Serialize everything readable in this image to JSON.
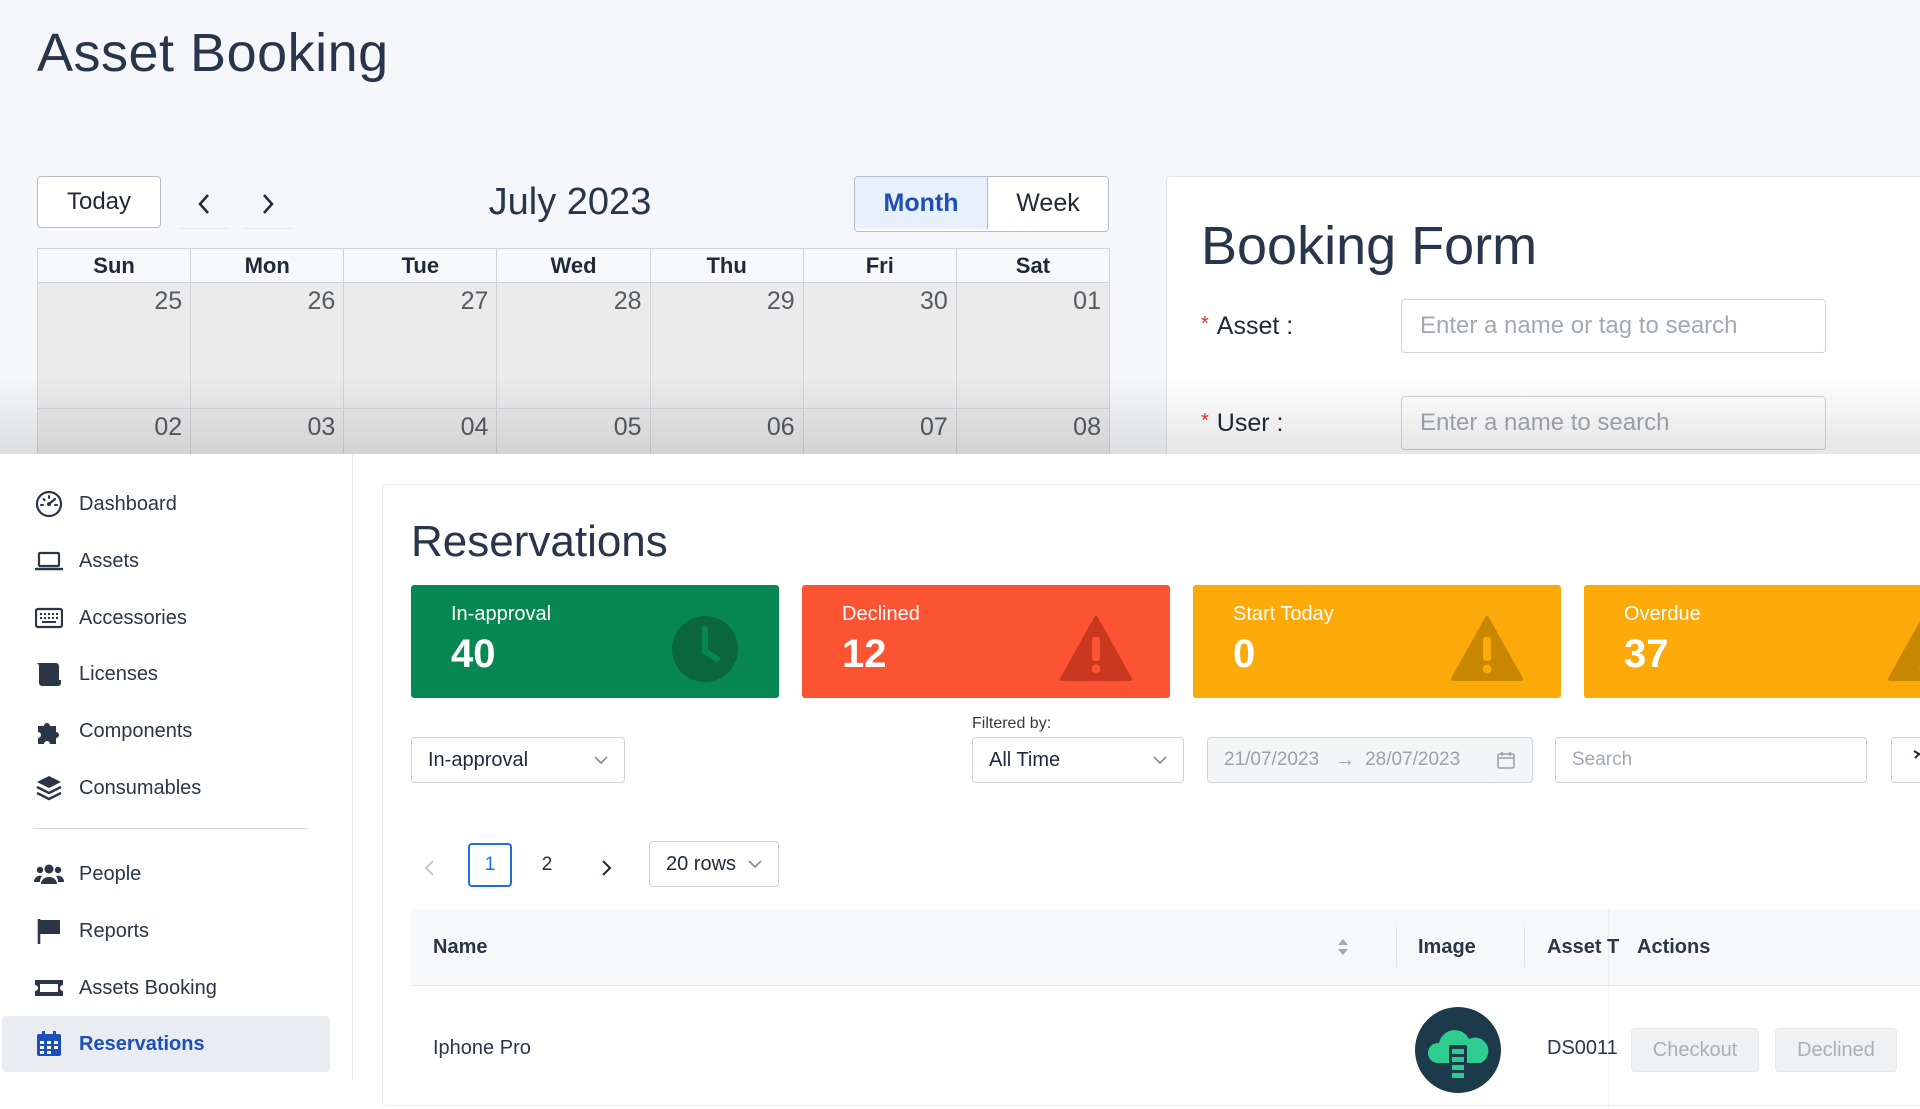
{
  "booking": {
    "title": "Asset Booking",
    "today_label": "Today",
    "month_label": "July 2023",
    "view_month": "Month",
    "view_week": "Week",
    "weekdays": [
      "Sun",
      "Mon",
      "Tue",
      "Wed",
      "Thu",
      "Fri",
      "Sat"
    ],
    "week1": [
      "25",
      "26",
      "27",
      "28",
      "29",
      "30",
      "01"
    ],
    "week2": [
      "02",
      "03",
      "04",
      "05",
      "06",
      "07",
      "08"
    ],
    "form": {
      "title": "Booking Form",
      "required_mark": "*",
      "asset_label": "Asset :",
      "asset_placeholder": "Enter a name or tag to search",
      "user_label": "User :",
      "user_placeholder": "Enter a name to search"
    }
  },
  "sidebar": {
    "items": [
      {
        "label": "Dashboard",
        "icon": "gauge-icon"
      },
      {
        "label": "Assets",
        "icon": "laptop-icon"
      },
      {
        "label": "Accessories",
        "icon": "keyboard-icon"
      },
      {
        "label": "Licenses",
        "icon": "scroll-icon"
      },
      {
        "label": "Components",
        "icon": "puzzle-icon"
      },
      {
        "label": "Consumables",
        "icon": "layers-icon"
      },
      {
        "label": "People",
        "icon": "people-icon"
      },
      {
        "label": "Reports",
        "icon": "flag-icon"
      },
      {
        "label": "Assets Booking",
        "icon": "ticket-icon"
      },
      {
        "label": "Reservations",
        "icon": "calendar-icon",
        "active": true
      }
    ]
  },
  "reservations": {
    "title": "Reservations",
    "stats": [
      {
        "label": "In-approval",
        "value": "40",
        "color": "#078852",
        "icon": "clock-icon"
      },
      {
        "label": "Declined",
        "value": "12",
        "color": "#fc5333",
        "icon": "warning-icon"
      },
      {
        "label": "Start Today",
        "value": "0",
        "color": "#fbaa09",
        "icon": "warning-icon"
      },
      {
        "label": "Overdue",
        "value": "37",
        "color": "#fbaa09",
        "icon": "warning-icon"
      }
    ],
    "status_filter": "In-approval",
    "filtered_by_label": "Filtered by:",
    "time_filter": "All Time",
    "date_from": "21/07/2023",
    "date_to": "28/07/2023",
    "date_arrow": "→",
    "search_placeholder": "Search",
    "pagination": {
      "pages": [
        "1",
        "2"
      ],
      "current": "1",
      "rows": "20 rows"
    },
    "table": {
      "columns": [
        "Name",
        "Image",
        "Asset T",
        "Actions"
      ],
      "rows": [
        {
          "name": "Iphone Pro",
          "asset_tag": "DS0011",
          "actions": [
            "Checkout",
            "Declined"
          ]
        }
      ]
    }
  },
  "colors": {
    "accent": "#1d4fb8",
    "link": "#1d6fdc",
    "title": "#27364b"
  }
}
